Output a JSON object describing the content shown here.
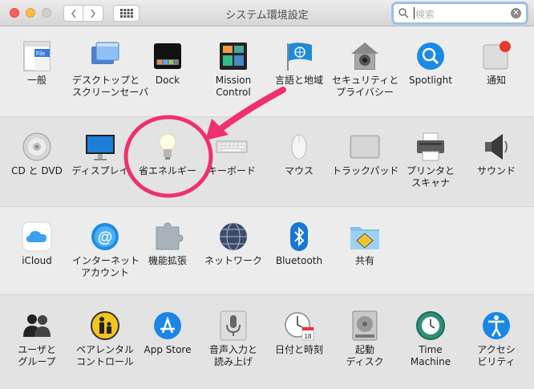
{
  "window": {
    "title": "システム環境設定",
    "search_placeholder": "検索"
  },
  "rows": [
    {
      "items": [
        {
          "id": "general",
          "label": [
            "一般"
          ],
          "icon": "general-icon"
        },
        {
          "id": "desktop",
          "label": [
            "デスクトップと",
            "スクリーンセーバ"
          ],
          "icon": "desktop-screensaver-icon"
        },
        {
          "id": "dock",
          "label": [
            "Dock"
          ],
          "icon": "dock-icon"
        },
        {
          "id": "mission-control",
          "label": [
            "Mission",
            "Control"
          ],
          "icon": "mission-control-icon"
        },
        {
          "id": "language",
          "label": [
            "言語と地域"
          ],
          "icon": "language-region-icon"
        },
        {
          "id": "security",
          "label": [
            "セキュリティと",
            "プライバシー"
          ],
          "icon": "security-house-icon"
        },
        {
          "id": "spotlight",
          "label": [
            "Spotlight"
          ],
          "icon": "spotlight-icon"
        },
        {
          "id": "notifications",
          "label": [
            "通知"
          ],
          "icon": "notifications-icon"
        }
      ]
    },
    {
      "items": [
        {
          "id": "cd-dvd",
          "label": [
            "CD と DVD"
          ],
          "icon": "cd-dvd-icon"
        },
        {
          "id": "displays",
          "label": [
            "ディスプレイ"
          ],
          "icon": "display-icon"
        },
        {
          "id": "energy-saver",
          "label": [
            "省エネルギー"
          ],
          "icon": "lightbulb-icon"
        },
        {
          "id": "keyboard",
          "label": [
            "キーボード"
          ],
          "icon": "keyboard-icon"
        },
        {
          "id": "mouse",
          "label": [
            "マウス"
          ],
          "icon": "mouse-icon"
        },
        {
          "id": "trackpad",
          "label": [
            "トラックパッド"
          ],
          "icon": "trackpad-icon"
        },
        {
          "id": "printers",
          "label": [
            "プリンタと",
            "スキャナ"
          ],
          "icon": "printer-icon"
        },
        {
          "id": "sound",
          "label": [
            "サウンド"
          ],
          "icon": "speaker-icon"
        }
      ]
    },
    {
      "items": [
        {
          "id": "icloud",
          "label": [
            "iCloud"
          ],
          "icon": "icloud-icon"
        },
        {
          "id": "internet-accounts",
          "label": [
            "インターネット",
            "アカウント"
          ],
          "icon": "internet-accounts-icon"
        },
        {
          "id": "extensions",
          "label": [
            "機能拡張"
          ],
          "icon": "puzzle-piece-icon"
        },
        {
          "id": "network",
          "label": [
            "ネットワーク"
          ],
          "icon": "network-globe-icon"
        },
        {
          "id": "bluetooth",
          "label": [
            "Bluetooth"
          ],
          "icon": "bluetooth-icon"
        },
        {
          "id": "sharing",
          "label": [
            "共有"
          ],
          "icon": "sharing-folder-icon"
        }
      ]
    },
    {
      "items": [
        {
          "id": "users",
          "label": [
            "ユーザと",
            "グループ"
          ],
          "icon": "users-groups-icon"
        },
        {
          "id": "parental",
          "label": [
            "ペアレンタル",
            "コントロール"
          ],
          "icon": "parental-controls-icon"
        },
        {
          "id": "app-store",
          "label": [
            "App Store"
          ],
          "icon": "app-store-icon"
        },
        {
          "id": "dictation",
          "label": [
            "音声入力と",
            "読み上げ"
          ],
          "icon": "microphone-icon"
        },
        {
          "id": "date-time",
          "label": [
            "日付と時刻"
          ],
          "icon": "clock-calendar-icon"
        },
        {
          "id": "startup-disk",
          "label": [
            "起動",
            "ディスク"
          ],
          "icon": "hard-disk-icon"
        },
        {
          "id": "time-machine",
          "label": [
            "Time",
            "Machine"
          ],
          "icon": "time-machine-icon"
        },
        {
          "id": "accessibility",
          "label": [
            "アクセシ",
            "ビリティ"
          ],
          "icon": "accessibility-icon"
        }
      ]
    }
  ],
  "annotation": {
    "highlighted_item": "energy-saver",
    "color": "#f0306e"
  }
}
